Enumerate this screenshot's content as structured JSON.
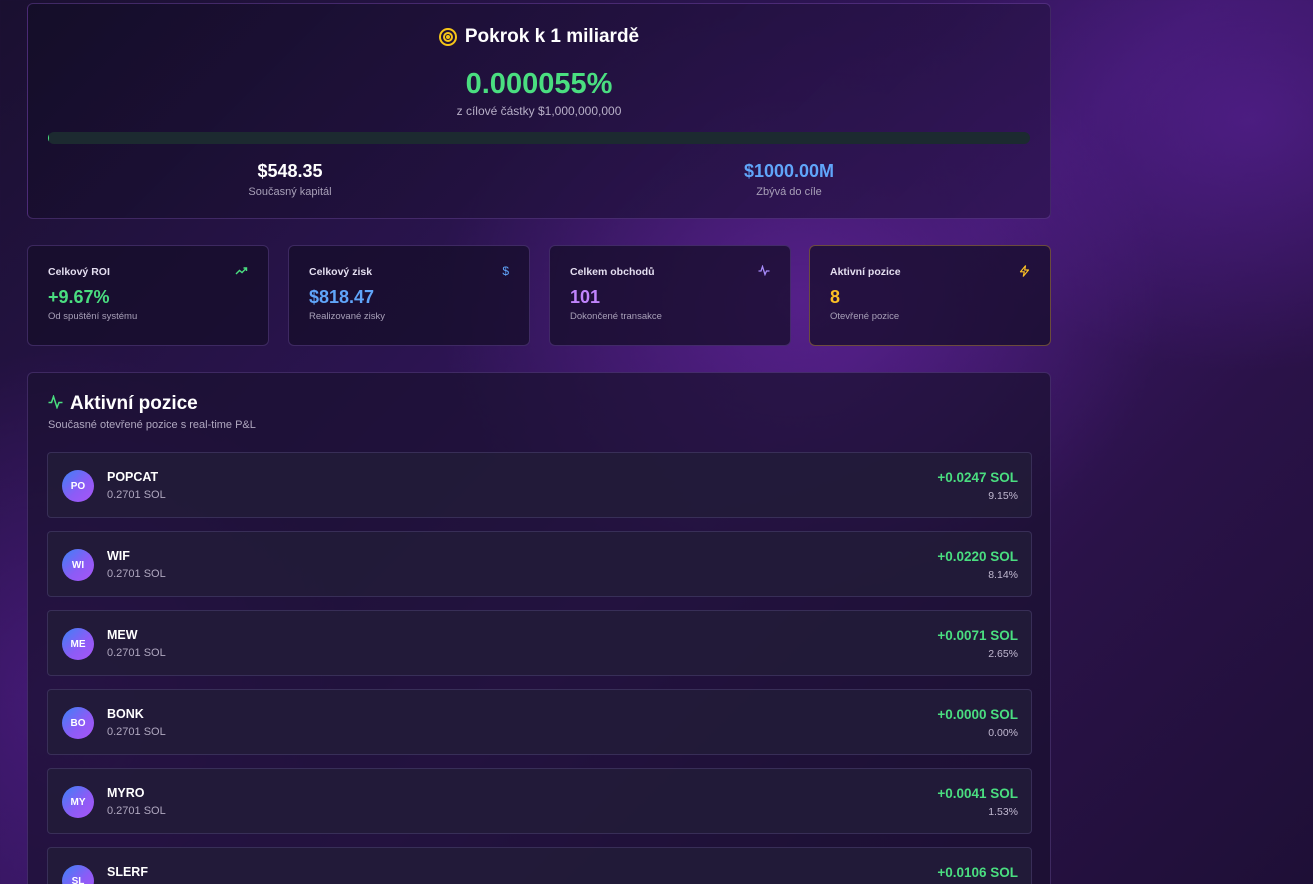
{
  "progress": {
    "title": "Pokrok k 1 miliardě",
    "title_icon": "target-icon",
    "percent": "0.000055%",
    "subtitle": "z cílové částky $1,000,000,000",
    "bar_fill_percent": 5.5e-05,
    "current_value": "$548.35",
    "current_label": "Současný kapitál",
    "remaining_value": "$1000.00M",
    "remaining_label": "Zbývá do cíle"
  },
  "stats": [
    {
      "label": "Celkový ROI",
      "value": "+9.67%",
      "desc": "Od spuštění systému",
      "icon": "trending-up-icon",
      "color": "#4ade80"
    },
    {
      "label": "Celkový zisk",
      "value": "$818.47",
      "desc": "Realizované zisky",
      "icon": "dollar-icon",
      "color": "#60a5fa"
    },
    {
      "label": "Celkem obchodů",
      "value": "101",
      "desc": "Dokončené transakce",
      "icon": "activity-icon",
      "color": "#c084fc"
    },
    {
      "label": "Aktivní pozice",
      "value": "8",
      "desc": "Otevřené pozice",
      "icon": "lightning-icon",
      "color": "#fbbf24"
    }
  ],
  "positions": {
    "title": "Aktivní pozice",
    "title_icon": "activity-icon",
    "subtitle": "Současné otevřené pozice s real-time P&L",
    "items": [
      {
        "initials": "PO",
        "name": "POPCAT",
        "size": "0.2701 SOL",
        "pnl": "+0.0247 SOL",
        "pct": "9.15%"
      },
      {
        "initials": "WI",
        "name": "WIF",
        "size": "0.2701 SOL",
        "pnl": "+0.0220 SOL",
        "pct": "8.14%"
      },
      {
        "initials": "ME",
        "name": "MEW",
        "size": "0.2701 SOL",
        "pnl": "+0.0071 SOL",
        "pct": "2.65%"
      },
      {
        "initials": "BO",
        "name": "BONK",
        "size": "0.2701 SOL",
        "pnl": "+0.0000 SOL",
        "pct": "0.00%"
      },
      {
        "initials": "MY",
        "name": "MYRO",
        "size": "0.2701 SOL",
        "pnl": "+0.0041 SOL",
        "pct": "1.53%"
      },
      {
        "initials": "SL",
        "name": "SLERF",
        "size": "",
        "pnl": "+0.0106 SOL",
        "pct": ""
      }
    ]
  },
  "colors": {
    "positive": "#4ade80",
    "accent_blue": "#60a5fa",
    "accent_purple": "#c084fc",
    "accent_yellow": "#fbbf24"
  }
}
